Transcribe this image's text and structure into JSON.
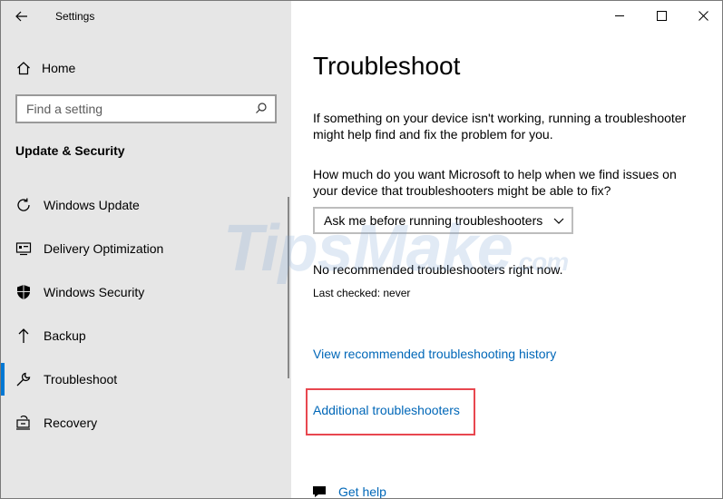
{
  "window": {
    "title": "Settings"
  },
  "sidebar": {
    "home_label": "Home",
    "search_placeholder": "Find a setting",
    "section_title": "Update & Security",
    "items": [
      {
        "label": "Windows Update",
        "icon": "refresh-icon"
      },
      {
        "label": "Delivery Optimization",
        "icon": "delivery-optimization-icon"
      },
      {
        "label": "Windows Security",
        "icon": "shield-icon"
      },
      {
        "label": "Backup",
        "icon": "backup-arrow-icon"
      },
      {
        "label": "Troubleshoot",
        "icon": "wrench-icon",
        "selected": true
      },
      {
        "label": "Recovery",
        "icon": "recovery-icon"
      }
    ]
  },
  "content": {
    "title": "Troubleshoot",
    "description": "If something on your device isn't working, running a troubleshooter might help find and fix the problem for you.",
    "question": "How much do you want Microsoft to help when we find issues on your device that troubleshooters might be able to fix?",
    "dropdown_value": "Ask me before running troubleshooters",
    "status": "No recommended troubleshooters right now.",
    "last_checked": "Last checked: never",
    "link_history": "View recommended troubleshooting history",
    "link_additional": "Additional troubleshooters",
    "get_help": "Get help"
  },
  "watermark": {
    "text": "TipsMake",
    "suffix": ".com"
  },
  "colors": {
    "accent": "#0078d4",
    "link": "#0067b8",
    "highlight": "#e8474f",
    "sidebar_bg": "#e6e6e6"
  }
}
